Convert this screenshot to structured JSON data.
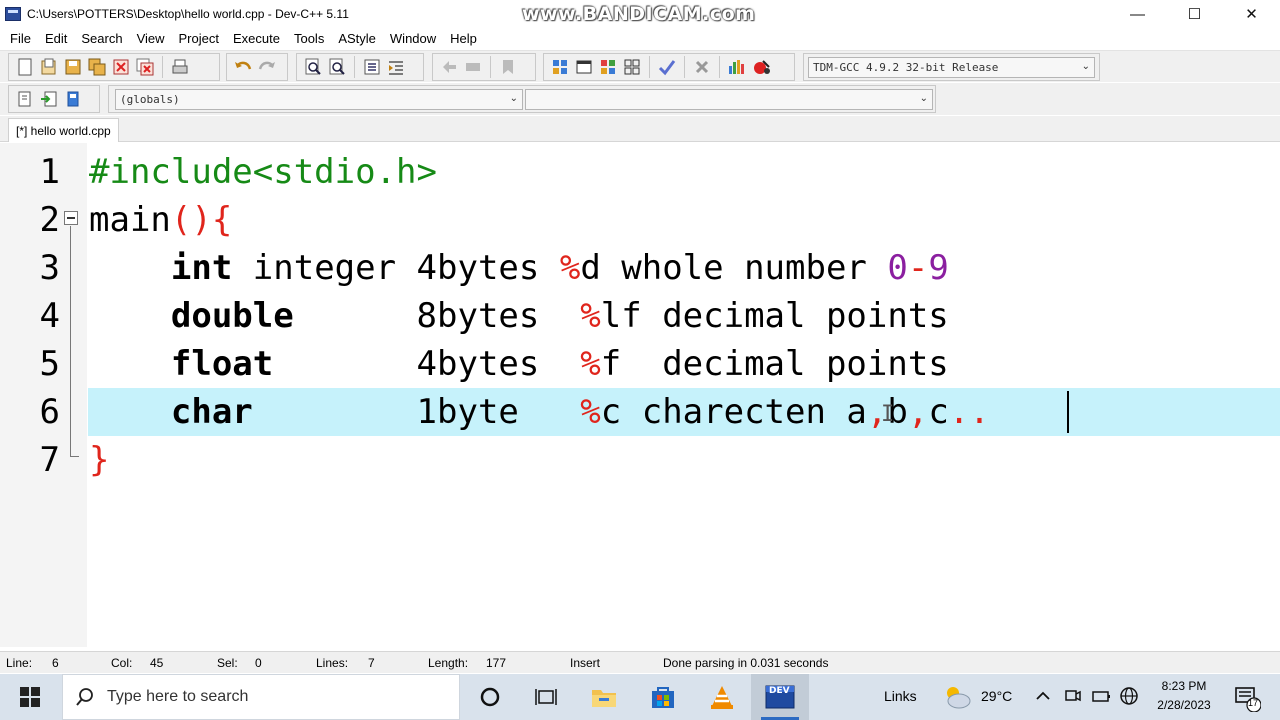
{
  "window": {
    "title": "C:\\Users\\POTTERS\\Desktop\\hello world.cpp - Dev-C++ 5.11",
    "watermark": "www.BANDICAM.com",
    "minimize": "—",
    "maximize": "☐",
    "close": "✕"
  },
  "menu": [
    "File",
    "Edit",
    "Search",
    "View",
    "Project",
    "Execute",
    "Tools",
    "AStyle",
    "Window",
    "Help"
  ],
  "toolbar": {
    "compiler": "TDM-GCC 4.9.2 32-bit Release",
    "scope": "(globals)",
    "member": ""
  },
  "tab": {
    "label": "[*] hello world.cpp"
  },
  "editor": {
    "line_numbers": [
      "1",
      "2",
      "3",
      "4",
      "5",
      "6",
      "7"
    ],
    "current_line": 6
  },
  "status": {
    "line_label": "Line:",
    "line_value": "6",
    "col_label": "Col:",
    "col_value": "45",
    "sel_label": "Sel:",
    "sel_value": "0",
    "lines_label": "Lines:",
    "lines_value": "7",
    "length_label": "Length:",
    "length_value": "177",
    "mode": "Insert",
    "message": "Done parsing in 0.031 seconds"
  },
  "taskbar": {
    "search_placeholder": "Type here to search",
    "links": "Links",
    "temperature": "29°C",
    "time": "8:23 PM",
    "date": "2/28/2023",
    "notification_count": "17",
    "devcpp_label": "DEV"
  },
  "colors": {
    "preprocessor": "#168a16",
    "symbol": "#e0251c",
    "number": "#8b1fa0",
    "current_line": "#c6f2fb",
    "taskbar": "#d9e2ec"
  }
}
